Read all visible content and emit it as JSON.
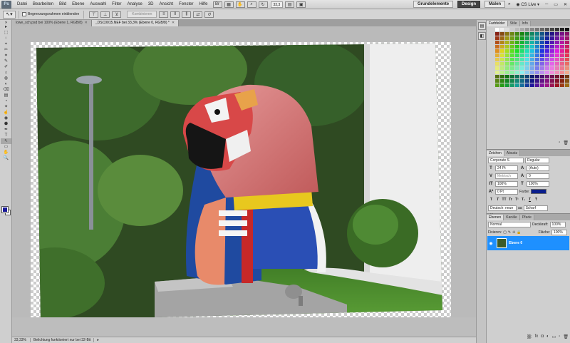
{
  "menubar": {
    "logo": "Ps",
    "items": [
      "Datei",
      "Bearbeiten",
      "Bild",
      "Ebene",
      "Auswahl",
      "Filter",
      "Analyse",
      "3D",
      "Ansicht",
      "Fenster",
      "Hilfe"
    ],
    "zoom": "33,3",
    "workspaces": [
      "Grundelemente",
      "Design",
      "Malen"
    ],
    "active_workspace": "Design",
    "cs_live": "CS Live"
  },
  "options": {
    "auto_select_label": "Begrenzungsrahmen einblenden",
    "combine_label": "Kombinieren"
  },
  "document_tabs": [
    {
      "label": "lowe_sch.psd bei 100% (Ebene 1, RGB/8)",
      "active": false
    },
    {
      "label": "_DSC0015.NEF bei 33,3% (Ebene 0, RGB/8) *",
      "active": true
    }
  ],
  "tools": [
    "▸",
    "⬚",
    "◌",
    "⌖",
    "✂",
    "⌗",
    "✎",
    "✐",
    "⌂",
    "◍",
    "◐",
    "⌫",
    "▤",
    "◔",
    "✦",
    "☝",
    "◉",
    "⬟",
    "✒",
    "T",
    "↖",
    "▭",
    "✋",
    "🔍",
    "",
    ""
  ],
  "colors": {
    "foreground": "#1a1a99",
    "background": "#ffffff",
    "layer_highlight": "#1e90ff",
    "text_color": "#0a1e8c"
  },
  "status": {
    "zoom": "33,33%",
    "message": "Belichtung funktioniert nur bei 32-Bit"
  },
  "swatches_panel": {
    "tabs": [
      "Farbfelder",
      "Stile",
      "Info"
    ]
  },
  "character_panel": {
    "tabs": [
      "Zeichen",
      "Absatz"
    ],
    "font_family": "Corporate S",
    "font_style": "Regular",
    "font_size": "24 Pt",
    "leading": "(Auto)",
    "kerning": "Metrisch",
    "tracking": "0",
    "vertical_scale": "100%",
    "horizontal_scale": "100%",
    "baseline_shift": "0 Pt",
    "color_label": "Farbe:",
    "language": "Deutsch: neue ...",
    "antialias": "Scharf",
    "style_buttons": [
      "T",
      "T",
      "TT",
      "Tr",
      "T¹",
      "T₁",
      "T",
      "Ŧ"
    ]
  },
  "layers_panel": {
    "tabs": [
      "Ebenen",
      "Kanäle",
      "Pfade"
    ],
    "blend_mode": "Normal",
    "opacity_label": "Deckkraft:",
    "opacity": "100%",
    "lock_label": "Fixieren:",
    "fill_label": "Fläche:",
    "fill": "100%",
    "layers": [
      {
        "name": "Ebene 0",
        "visible": true,
        "selected": true
      }
    ]
  }
}
